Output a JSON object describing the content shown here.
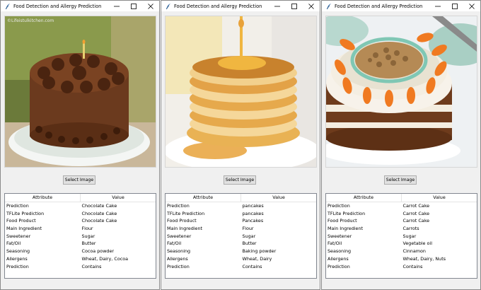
{
  "windows": [
    {
      "title": "Food Detection and Allergy Prediction",
      "button_label": "Select Image",
      "watermark": "©Lifeistulkitchen.com",
      "table": {
        "headers": [
          "Attribute",
          "Value"
        ],
        "rows": [
          [
            "Prediction",
            "Chocolate Cake"
          ],
          [
            "TFLite Prediction",
            "Chocolate Cake"
          ],
          [
            "Food Product",
            "Chocolate Cake"
          ],
          [
            "Main Ingredient",
            "Flour"
          ],
          [
            "Sweetener",
            "Sugar"
          ],
          [
            "Fat/Oil",
            "Butter"
          ],
          [
            "Seasoning",
            "Cocoa powder"
          ],
          [
            "Allergens",
            "Wheat, Dairy, Cocoa"
          ],
          [
            "Prediction",
            "Contains"
          ]
        ]
      }
    },
    {
      "title": "Food Detection and Allergy Prediction",
      "button_label": "Select Image",
      "table": {
        "headers": [
          "Attribute",
          "Value"
        ],
        "rows": [
          [
            "Prediction",
            "pancakes"
          ],
          [
            "TFLite Prediction",
            "pancakes"
          ],
          [
            "Food Product",
            "Pancakes"
          ],
          [
            "Main Ingredient",
            "Flour"
          ],
          [
            "Sweetener",
            "Sugar"
          ],
          [
            "Fat/Oil",
            "Butter"
          ],
          [
            "Seasoning",
            "Baking powder"
          ],
          [
            "Allergens",
            "Wheat, Dairy"
          ],
          [
            "Prediction",
            "Contains"
          ]
        ]
      }
    },
    {
      "title": "Food Detection and Allergy Prediction",
      "button_label": "Select Image",
      "table": {
        "headers": [
          "Attribute",
          "Value"
        ],
        "rows": [
          [
            "Prediction",
            "Carrot Cake"
          ],
          [
            "TFLite Prediction",
            "Carrot Cake"
          ],
          [
            "Food Product",
            "Carrot Cake"
          ],
          [
            "Main Ingredient",
            "Carrots"
          ],
          [
            "Sweetener",
            "Sugar"
          ],
          [
            "Fat/Oil",
            "Vegetable oil"
          ],
          [
            "Seasoning",
            "Cinnamon"
          ],
          [
            "Allergens",
            "Wheat, Dairy, Nuts"
          ],
          [
            "Prediction",
            "Contains"
          ]
        ]
      }
    }
  ],
  "icons": {
    "app": "feather-icon",
    "minimize": "minimize-icon",
    "maximize": "maximize-icon",
    "close": "close-icon"
  },
  "colors": {
    "window_bg": "#f0f0f0",
    "button_bg": "#e1e1e1",
    "table_border": "#828790"
  }
}
